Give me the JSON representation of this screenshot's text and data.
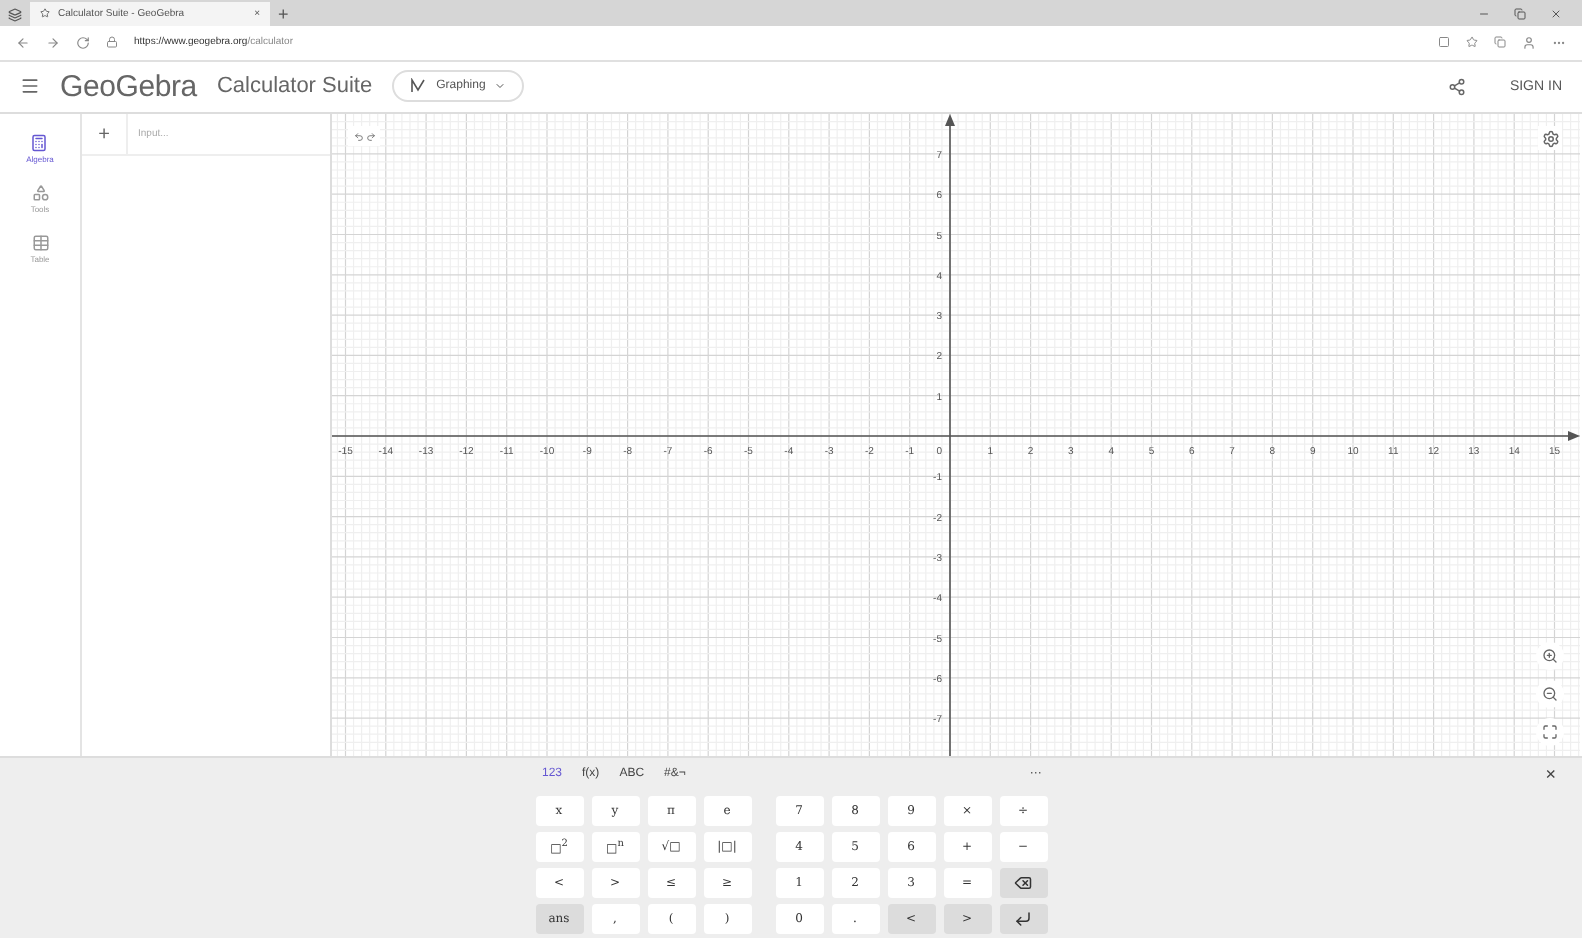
{
  "browser": {
    "tab_title": "Calculator Suite - GeoGebra",
    "tab_close": "×",
    "new_tab": "+",
    "url_host": "https://www.geogebra.org",
    "url_path": "/calculator"
  },
  "header": {
    "logo": "GeoGebra",
    "title": "Calculator Suite",
    "app_button": "Graphing",
    "sign_in": "SIGN IN"
  },
  "rail": [
    {
      "label": "Algebra",
      "kind": "algebra",
      "selected": true
    },
    {
      "label": "Tools",
      "kind": "tools",
      "selected": false
    },
    {
      "label": "Table",
      "kind": "table",
      "selected": false
    }
  ],
  "algebra": {
    "add": "+",
    "placeholder": "Input..."
  },
  "graph": {
    "x_labels": [
      "-15",
      "-14",
      "-13",
      "-12",
      "-11",
      "-10",
      "-9",
      "-8",
      "-7",
      "-6",
      "-5",
      "-4",
      "-3",
      "-2",
      "-1",
      "1",
      "2",
      "3",
      "4",
      "5",
      "6",
      "7",
      "8",
      "9",
      "10",
      "11",
      "12",
      "13",
      "14",
      "15"
    ],
    "y_labels": [
      "7",
      "6",
      "5",
      "4",
      "3",
      "2",
      "1",
      "-1",
      "-2",
      "-3",
      "-4",
      "-5",
      "-6",
      "-7"
    ],
    "origin": "0"
  },
  "keyboard": {
    "tabs": [
      {
        "label": "123",
        "selected": true
      },
      {
        "label": "f(x)",
        "selected": false
      },
      {
        "label": "ABC",
        "selected": false
      },
      {
        "label": "#&¬",
        "selected": false
      }
    ],
    "more": "···",
    "close": "×",
    "left_keys": [
      {
        "label": "x",
        "kind": "plain"
      },
      {
        "label": "y",
        "kind": "plain"
      },
      {
        "label": "π",
        "kind": "plain"
      },
      {
        "label": "e",
        "kind": "plain"
      },
      {
        "label": "□$^{2}$",
        "kind": "plain"
      },
      {
        "label": "□$^{n}$",
        "kind": "plain"
      },
      {
        "label": "√□",
        "kind": "plain"
      },
      {
        "label": "|□|",
        "kind": "plain"
      },
      {
        "label": "<",
        "kind": "plain"
      },
      {
        "label": ">",
        "kind": "plain"
      },
      {
        "label": "≤",
        "kind": "plain"
      },
      {
        "label": "≥",
        "kind": "plain"
      },
      {
        "label": "ans",
        "kind": "func"
      },
      {
        "label": ",",
        "kind": "plain"
      },
      {
        "label": "(",
        "kind": "plain"
      },
      {
        "label": ")",
        "kind": "plain"
      }
    ],
    "right_keys": [
      {
        "label": "7",
        "kind": "plain"
      },
      {
        "label": "8",
        "kind": "plain"
      },
      {
        "label": "9",
        "kind": "plain"
      },
      {
        "label": "×",
        "kind": "plain"
      },
      {
        "label": "÷",
        "kind": "plain"
      },
      {
        "label": "4",
        "kind": "plain"
      },
      {
        "label": "5",
        "kind": "plain"
      },
      {
        "label": "6",
        "kind": "plain"
      },
      {
        "label": "+",
        "kind": "plain"
      },
      {
        "label": "−",
        "kind": "plain"
      },
      {
        "label": "1",
        "kind": "plain"
      },
      {
        "label": "2",
        "kind": "plain"
      },
      {
        "label": "3",
        "kind": "plain"
      },
      {
        "label": "=",
        "kind": "plain"
      },
      {
        "kind": "backspace"
      },
      {
        "label": "0",
        "kind": "plain"
      },
      {
        "label": ".",
        "kind": "plain"
      },
      {
        "label": "<",
        "kind": "func"
      },
      {
        "label": ">",
        "kind": "func"
      },
      {
        "kind": "enter"
      }
    ]
  }
}
